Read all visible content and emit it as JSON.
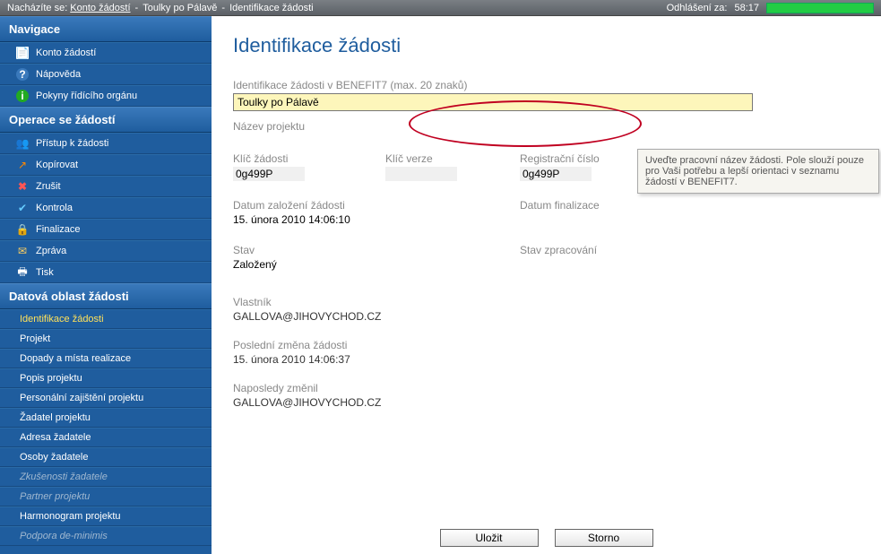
{
  "topbar": {
    "prefix": "Nacházíte se:",
    "crumb1": "Konto žádostí",
    "crumb2": "Toulky po Pálavě",
    "crumb3": "Identifikace žádosti",
    "logout_label": "Odhlášení za:",
    "logout_time": "58:17"
  },
  "sidebar": {
    "nav_header": "Navigace",
    "nav_items": [
      {
        "label": "Konto žádostí",
        "icon": "account"
      },
      {
        "label": "Nápověda",
        "icon": "help"
      },
      {
        "label": "Pokyny řídícího orgánu",
        "icon": "info"
      }
    ],
    "ops_header": "Operace se žádostí",
    "ops_items": [
      {
        "label": "Přístup k žádosti",
        "icon": "users"
      },
      {
        "label": "Kopírovat",
        "icon": "copy"
      },
      {
        "label": "Zrušit",
        "icon": "cancel"
      },
      {
        "label": "Kontrola",
        "icon": "check"
      },
      {
        "label": "Finalizace",
        "icon": "lock"
      },
      {
        "label": "Zpráva",
        "icon": "mail"
      },
      {
        "label": "Tisk",
        "icon": "print"
      }
    ],
    "data_header": "Datová oblast žádosti",
    "data_items": [
      {
        "label": "Identifikace žádosti",
        "active": true
      },
      {
        "label": "Projekt"
      },
      {
        "label": "Dopady a místa realizace"
      },
      {
        "label": "Popis projektu"
      },
      {
        "label": "Personální zajištění projektu"
      },
      {
        "label": "Žadatel projektu"
      },
      {
        "label": "Adresa žadatele"
      },
      {
        "label": "Osoby žadatele"
      },
      {
        "label": "Zkušenosti žadatele",
        "disabled": true
      },
      {
        "label": "Partner projektu",
        "disabled": true
      },
      {
        "label": "Harmonogram projektu"
      },
      {
        "label": "Podpora de-minimis",
        "disabled": true
      }
    ]
  },
  "content": {
    "title": "Identifikace žádosti",
    "ident_label": "Identifikace žádosti v BENEFIT7 (max. 20 znaků)",
    "ident_value": "Toulky po Pálavě",
    "project_name_label": "Název projektu",
    "tooltip": "Uveďte pracovní název žádosti. Pole slouží pouze pro Vaši potřebu a lepší orientaci v seznamu žádostí v BENEFIT7.",
    "key_label": "Klíč žádosti",
    "key_value": "0g499P",
    "version_label": "Klíč verze",
    "reg_label": "Registrační číslo",
    "reg_value": "0g499P",
    "created_label": "Datum založení žádosti",
    "created_value": "15. února 2010 14:06:10",
    "final_label": "Datum finalizace",
    "state_label": "Stav",
    "state_value": "Založený",
    "processing_label": "Stav zpracování",
    "owner_label": "Vlastník",
    "owner_value": "GALLOVA@JIHOVYCHOD.CZ",
    "lastchange_label": "Poslední změna žádosti",
    "lastchange_value": "15. února 2010 14:06:37",
    "changedby_label": "Naposledy změnil",
    "changedby_value": "GALLOVA@JIHOVYCHOD.CZ",
    "save_btn": "Uložit",
    "cancel_btn": "Storno"
  }
}
